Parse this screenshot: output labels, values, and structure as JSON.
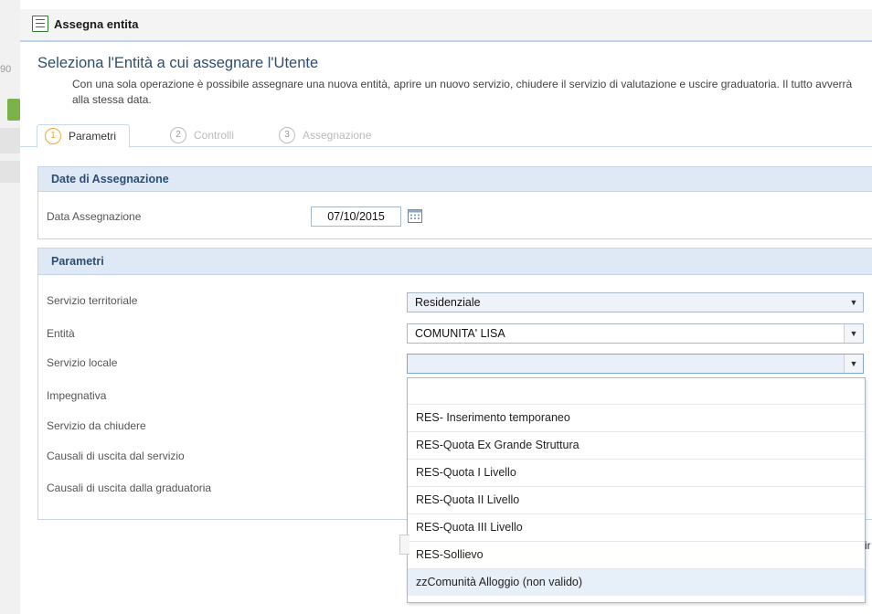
{
  "left_edge": {
    "partial_text": "90"
  },
  "window": {
    "title": "Assegna entita"
  },
  "heading": "Seleziona l'Entità a cui assegnare l'Utente",
  "description": "Con una sola operazione è possibile assegnare una nuova entità, aprire un nuovo servizio, chiudere il servizio di valutazione e uscire graduatoria. Il tutto avverrà alla stessa data.",
  "tabs": [
    {
      "num": "1",
      "label": "Parametri",
      "active": true
    },
    {
      "num": "2",
      "label": "Controlli",
      "active": false
    },
    {
      "num": "3",
      "label": "Assegnazione",
      "active": false
    }
  ],
  "date_panel": {
    "title": "Date di Assegnazione",
    "date_label": "Data Assegnazione",
    "date_value": "07/10/2015"
  },
  "params_panel": {
    "title": "Parametri",
    "labels": [
      "Servizio territoriale",
      "Entità",
      "Servizio locale",
      "Impegnativa",
      "Servizio da chiudere",
      "Causali di uscita dal servizio",
      "Causali di uscita dalla graduatoria"
    ],
    "servizio_territoriale": "Residenziale",
    "entita": "COMUNITA' LISA",
    "servizio_locale": ""
  },
  "dropdown_options": [
    "",
    "RES- Inserimento temporaneo",
    "RES-Quota Ex Grande Struttura",
    "RES-Quota I Livello",
    "RES-Quota II Livello",
    "RES-Quota III Livello",
    "RES-Sollievo",
    "zzComunità Alloggio (non valido)"
  ],
  "footer": {
    "partial_text": "ir"
  },
  "colors": {
    "accent": "#2d4d74",
    "panel_header": "#dfe9f5",
    "active_tab_number": "#f0a830"
  },
  "icons": {
    "title": "form-icon",
    "calendar": "calendar-icon",
    "select_arrow": "chevron-down-icon"
  }
}
